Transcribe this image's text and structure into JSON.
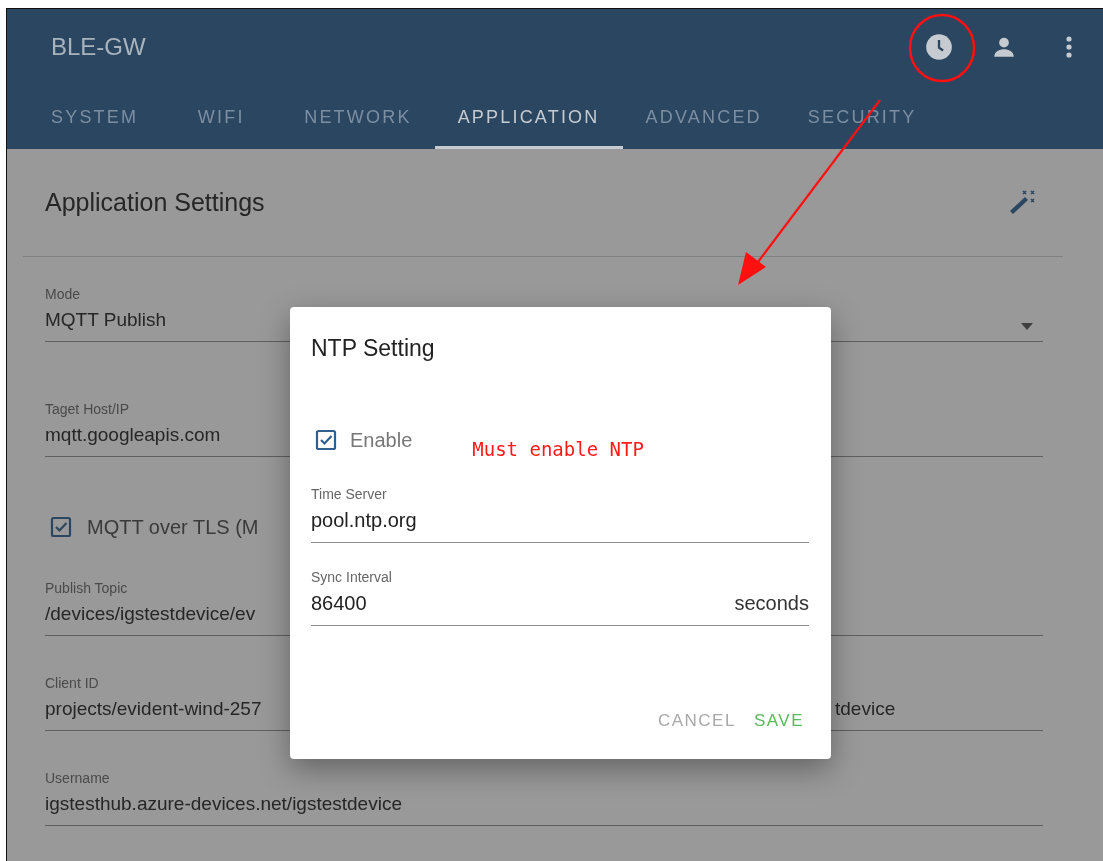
{
  "app_bar": {
    "title": "BLE-GW"
  },
  "tabs": [
    {
      "label": "SYSTEM",
      "selected": false
    },
    {
      "label": "WIFI",
      "selected": false
    },
    {
      "label": "NETWORK",
      "selected": false
    },
    {
      "label": "APPLICATION",
      "selected": true
    },
    {
      "label": "ADVANCED",
      "selected": false
    },
    {
      "label": "SECURITY",
      "selected": false
    }
  ],
  "card": {
    "title": "Application Settings",
    "fields": [
      {
        "kind": "select",
        "label": "Mode",
        "value": "MQTT Publish"
      },
      {
        "kind": "text",
        "label": "Taget Host/IP",
        "value": "mqtt.googleapis.com"
      },
      {
        "kind": "checkbox",
        "label": "MQTT over TLS (M",
        "checked": true
      },
      {
        "kind": "text",
        "label": "Publish Topic",
        "value": "/devices/igstestdevice/ev"
      },
      {
        "kind": "split",
        "label": "Client ID",
        "value": "projects/evident-wind-257",
        "value_right": "tdevice"
      },
      {
        "kind": "text",
        "label": "Username",
        "value": "igstesthub.azure-devices.net/igstestdevice"
      }
    ]
  },
  "dialog": {
    "title": "NTP Setting",
    "enable": {
      "label": "Enable",
      "checked": true
    },
    "note": "Must enable NTP",
    "fields": [
      {
        "label": "Time Server",
        "value": "pool.ntp.org"
      },
      {
        "label": "Sync Interval",
        "value": "86400",
        "unit": "seconds"
      }
    ],
    "buttons": [
      {
        "label": "CANCEL",
        "kind": "cancel"
      },
      {
        "label": "SAVE",
        "kind": "primary"
      }
    ]
  }
}
